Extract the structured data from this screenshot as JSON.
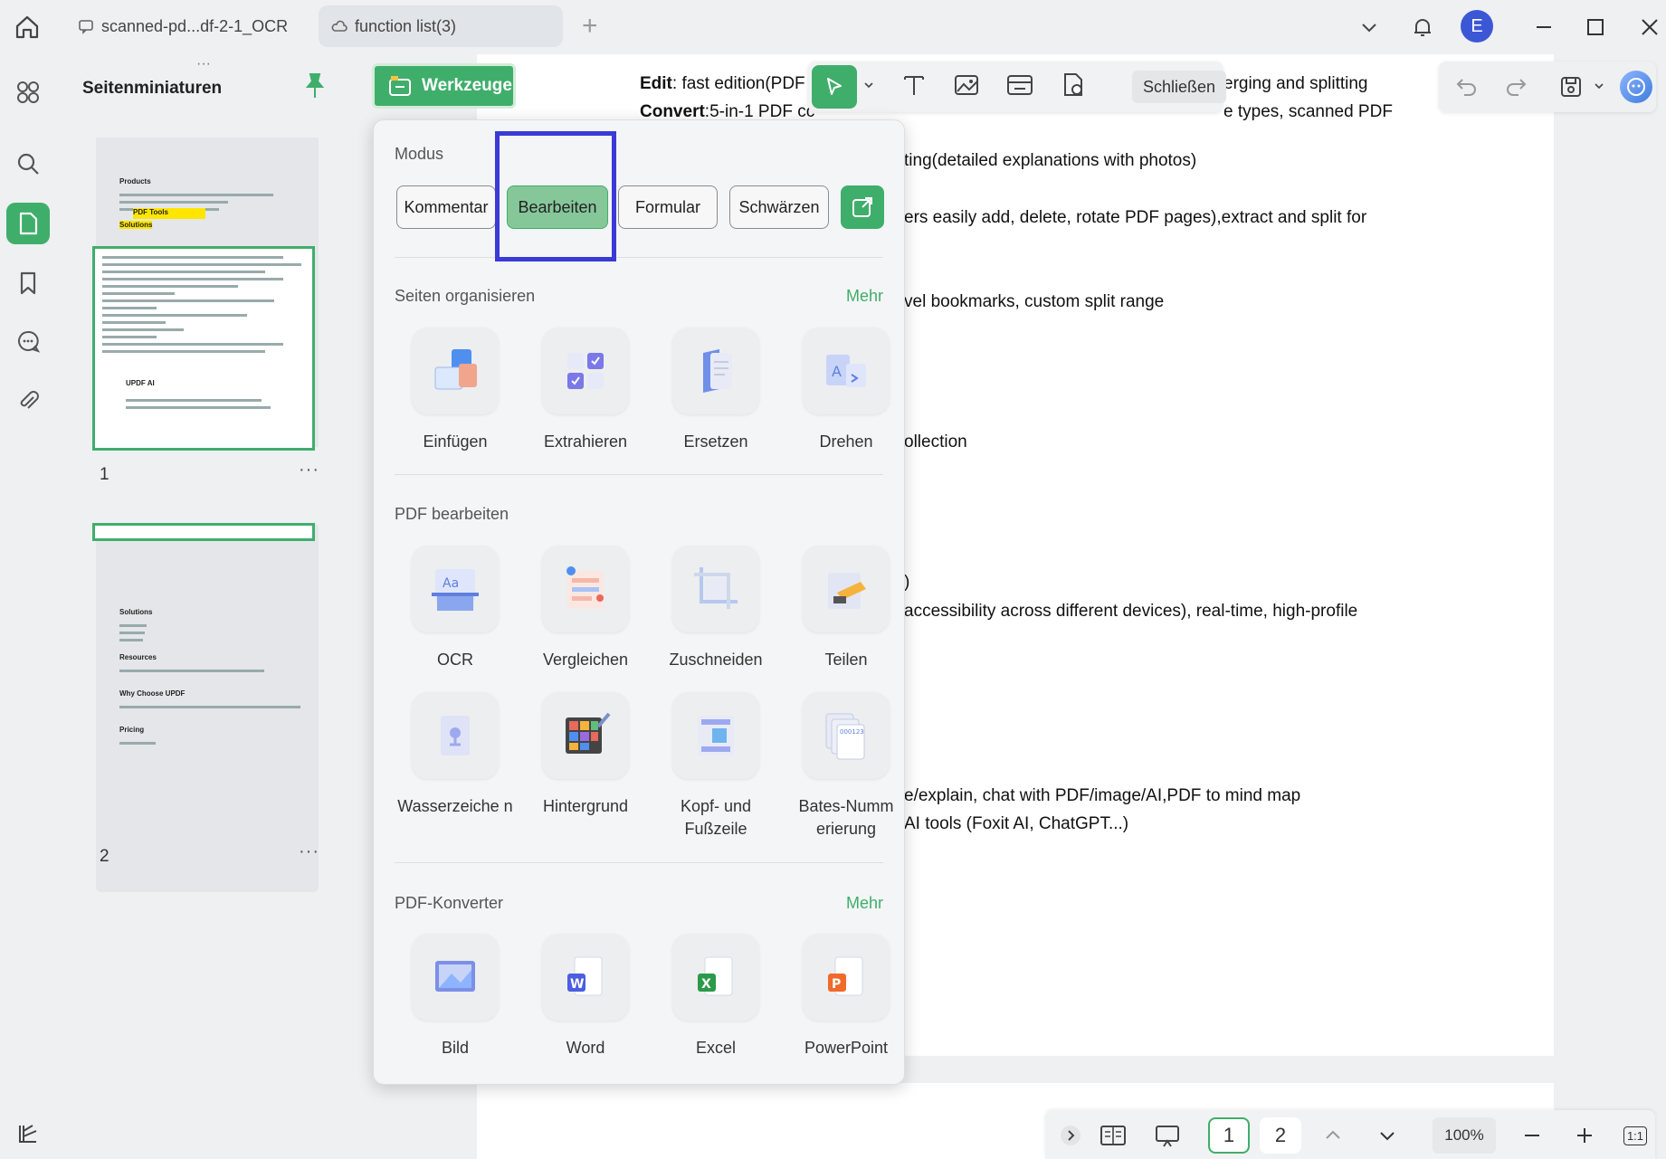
{
  "tabs": [
    {
      "label": "scanned-pd...df-2-1_OCR"
    },
    {
      "label": "function list(3)"
    }
  ],
  "user": {
    "avatar_letter": "E"
  },
  "sidebar": {
    "title": "Seitenminiaturen"
  },
  "thumbnails": [
    {
      "page": "1",
      "more": "···"
    },
    {
      "page": "2",
      "more": "···"
    }
  ],
  "mini_page1": {
    "h1": "Products",
    "h2": "PDF Tools",
    "h3": "UPDF AI"
  },
  "mini_page2": {
    "h1": "Solutions",
    "h2": "Resources",
    "h3": "Why Choose UPDF",
    "h4": "Pricing"
  },
  "toolbar": {
    "close_label": "Schließen",
    "tools_label": "Werkzeuge"
  },
  "document": {
    "line_edit_label": "Edit",
    "line_edit_text": ": fast edition(PDF",
    "line_edit_right": "erging and splitting",
    "line_convert_label": "Convert",
    "line_convert_text": ":5-in-1 PDF cc",
    "line_convert_right": "e types, scanned PDF",
    "lines": [
      "ting(detailed explanations with photos)",
      "ers easily add, delete, rotate PDF pages),extract and split for",
      "vel bookmarks, custom split range",
      "ollection",
      ")",
      "accessibility  across  different  devices),  real-time,  high-profile",
      "e/explain, chat with PDF/image/AI,PDF to mind map",
      "AI tools (Foxit AI, ChatGPT...)"
    ]
  },
  "panel": {
    "mode_title": "Modus",
    "modes": [
      "Kommentar",
      "Bearbeiten",
      "Formular",
      "Schwärzen"
    ],
    "active_mode": "Bearbeiten",
    "organize_title": "Seiten organisieren",
    "organize_more": "Mehr",
    "organize_tools": [
      "Einfügen",
      "Extrahieren",
      "Ersetzen",
      "Drehen"
    ],
    "edit_title": "PDF bearbeiten",
    "edit_tools_row1": [
      "OCR",
      "Vergleichen",
      "Zuschneiden",
      "Teilen"
    ],
    "edit_tools_row2": [
      "Wasserzeiche n",
      "Hintergrund",
      "Kopf- und Fußzeile",
      "Bates-Numm erierung"
    ],
    "convert_title": "PDF-Konverter",
    "convert_more": "Mehr",
    "convert_tools": [
      "Bild",
      "Word",
      "Excel",
      "PowerPoint"
    ]
  },
  "statusbar": {
    "page1": "1",
    "page2": "2",
    "zoom": "100%",
    "fit": "1:1"
  },
  "colors": {
    "accent": "#3fae6b",
    "highlight": "#3a3ad6",
    "avatar": "#3c57d6"
  }
}
